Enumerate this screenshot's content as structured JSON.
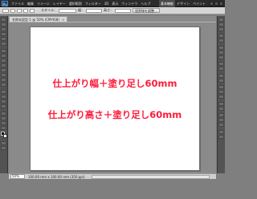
{
  "app": {
    "logo": "Ps",
    "menus": [
      "ファイル",
      "編集",
      "イメージ",
      "レイヤー",
      "選択範囲",
      "フィルター",
      "3D",
      "表示",
      "ウィンドウ",
      "ヘルプ"
    ],
    "workspaces": [
      "基本機能",
      "デザイン",
      "ペイント"
    ]
  },
  "options": {
    "label_mode": "スタイル：",
    "label_width": "幅：",
    "label_height": "高さ：",
    "refine_button": "境界線を調整..."
  },
  "document": {
    "tab_title": "名称未設定-1 @ 50% (CMYK/8)",
    "close_glyph": "×",
    "canvas_line1": "仕上がり幅＋塗り足し60mm",
    "canvas_line2": "仕上がり高さ＋塗り足し60mm"
  },
  "status": {
    "zoom": "50%",
    "doc_info": "100.00 mm x 100.00 mm (350 ppi)"
  },
  "colors": {
    "canvas_text": "#ff1a3a",
    "foreground_swatch": "#000000",
    "background_swatch": "#ffffff"
  }
}
